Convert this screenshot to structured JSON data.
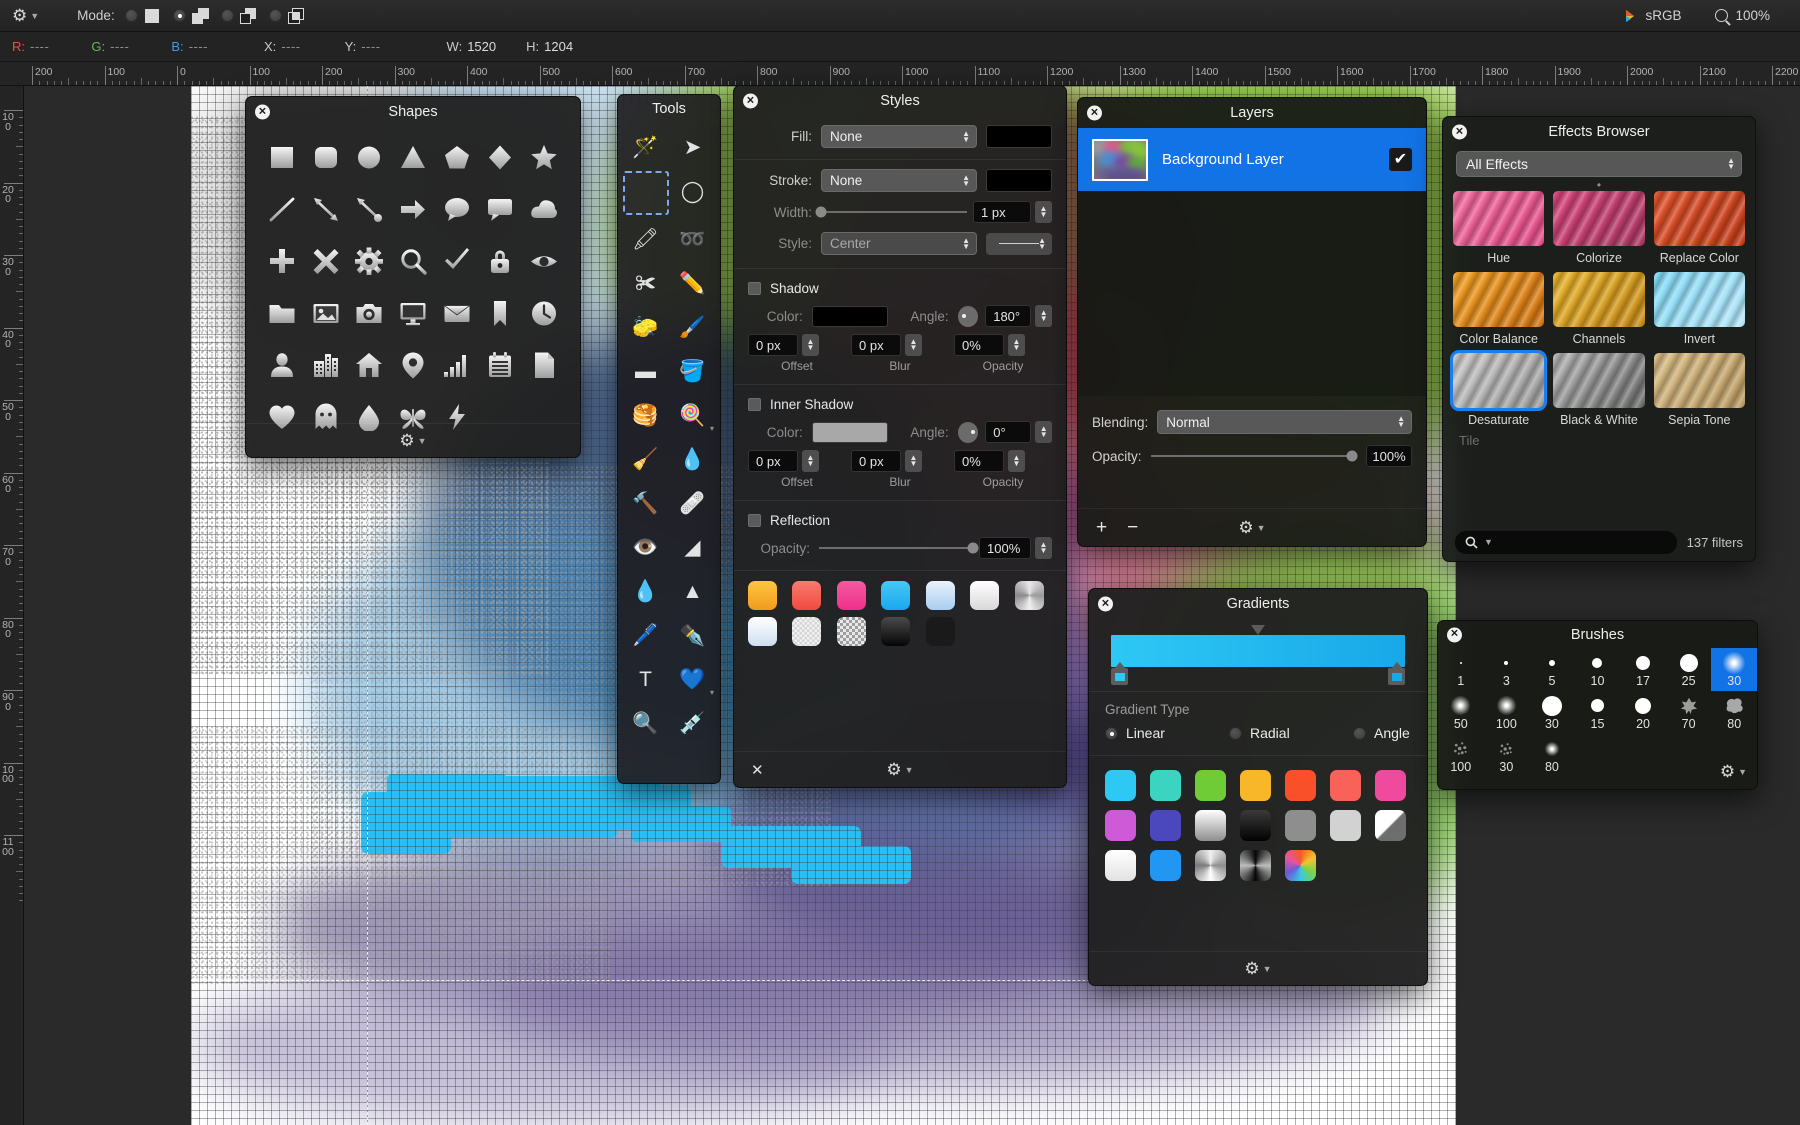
{
  "toolbar": {
    "gear_icon": "gear-icon",
    "mode_label": "Mode:",
    "modes": [
      {
        "name": "new-selection",
        "selected": false,
        "icon": "solid-square-icon"
      },
      {
        "name": "add-to-selection",
        "selected": true,
        "icon": "union-squares-icon"
      },
      {
        "name": "subtract-from-selection",
        "selected": false,
        "icon": "subtract-squares-icon"
      },
      {
        "name": "intersect-selection",
        "selected": false,
        "icon": "intersect-squares-icon"
      }
    ],
    "color_profile": "sRGB",
    "zoom_level": "100%",
    "search_icon": "magnifier-icon"
  },
  "infobar": {
    "r_key": "R:",
    "r_val": "----",
    "g_key": "G:",
    "g_val": "----",
    "b_key": "B:",
    "b_val": "----",
    "x_key": "X:",
    "x_val": "----",
    "y_key": "Y:",
    "y_val": "----",
    "w_key": "W:",
    "w_val": "1520",
    "h_key": "H:",
    "h_val": "1204"
  },
  "rulers": {
    "horizontal_labels": [
      "200",
      "100",
      "0",
      "100",
      "200",
      "300",
      "400",
      "500",
      "600",
      "700",
      "800",
      "900",
      "1000",
      "1100",
      "1200",
      "1300",
      "1400",
      "1500",
      "1600",
      "1700",
      "1800",
      "1900",
      "2000",
      "2100",
      "2200"
    ],
    "vertical_labels": [
      "100",
      "200",
      "300",
      "400",
      "500",
      "600",
      "700",
      "800",
      "900",
      "1000",
      "1100"
    ]
  },
  "shapes_panel": {
    "title": "Shapes",
    "close_icon": "close-icon",
    "gear_icon": "gear-icon",
    "shapes": [
      "square-icon",
      "rounded-square-icon",
      "circle-icon",
      "triangle-icon",
      "pentagon-icon",
      "diamond-icon",
      "star-icon",
      "line-icon",
      "double-arrow-icon",
      "arrow-dot-icon",
      "arrow-right-icon",
      "speech-bubble-round-icon",
      "speech-bubble-square-icon",
      "cloud-icon",
      "plus-icon",
      "cross-icon",
      "gear-icon",
      "magnifier-icon",
      "checkmark-icon",
      "lock-icon",
      "eye-icon",
      "folder-icon",
      "photo-icon",
      "camera-icon",
      "monitor-icon",
      "envelope-icon",
      "bookmark-icon",
      "clock-icon",
      "person-icon",
      "buildings-icon",
      "house-icon",
      "map-pin-icon",
      "bar-chart-icon",
      "calendar-icon",
      "document-icon",
      "heart-icon",
      "ghost-icon",
      "droplet-icon",
      "butterfly-icon",
      "bolt-icon"
    ]
  },
  "tools_panel": {
    "title": "Tools",
    "close_icon": "close-icon",
    "tools": [
      {
        "name": "magic-wand-tool",
        "glyph": "🪄",
        "selected": false
      },
      {
        "name": "move-selection-tool",
        "glyph": "➤",
        "selected": false
      },
      {
        "name": "rectangular-marquee-tool",
        "glyph": "",
        "selected": true
      },
      {
        "name": "elliptical-marquee-tool",
        "glyph": "◯",
        "selected": false
      },
      {
        "name": "quick-select-tool",
        "glyph": "🖍",
        "selected": false
      },
      {
        "name": "lasso-tool",
        "glyph": "➿",
        "selected": false
      },
      {
        "name": "crop-tool",
        "glyph": "✀",
        "selected": false
      },
      {
        "name": "pencil-tool",
        "glyph": "✏️",
        "selected": false
      },
      {
        "name": "eraser-tool",
        "glyph": "🧽",
        "selected": false
      },
      {
        "name": "paintbrush-tool",
        "glyph": "🖌️",
        "selected": false
      },
      {
        "name": "fill-rectangle-tool",
        "glyph": "▬",
        "selected": false
      },
      {
        "name": "paint-bucket-tool",
        "glyph": "🪣",
        "selected": false
      },
      {
        "name": "gradient-tool",
        "glyph": "🥞",
        "selected": false
      },
      {
        "name": "color-picker-palette-tool",
        "glyph": "🍭",
        "selected": false
      },
      {
        "name": "smudge-tool",
        "glyph": "🧹",
        "selected": false
      },
      {
        "name": "burn-tool",
        "glyph": "💧",
        "selected": false
      },
      {
        "name": "clone-stamp-tool",
        "glyph": "🔨",
        "selected": false
      },
      {
        "name": "healing-brush-tool",
        "glyph": "🩹",
        "selected": false
      },
      {
        "name": "red-eye-tool",
        "glyph": "👁️",
        "selected": false
      },
      {
        "name": "background-eraser-tool",
        "glyph": "◢",
        "selected": false
      },
      {
        "name": "blur-tool",
        "glyph": "💧",
        "selected": false
      },
      {
        "name": "sharpen-tool",
        "glyph": "▲",
        "selected": false
      },
      {
        "name": "pen-tool",
        "glyph": "🖊️",
        "selected": false
      },
      {
        "name": "freeform-pen-tool",
        "glyph": "✒️",
        "selected": false
      },
      {
        "name": "text-tool",
        "glyph": "T",
        "selected": false
      },
      {
        "name": "shape-tool",
        "glyph": "💙",
        "selected": false
      },
      {
        "name": "zoom-tool",
        "glyph": "🔍",
        "selected": false
      },
      {
        "name": "eyedropper-tool",
        "glyph": "💉",
        "selected": false
      }
    ]
  },
  "styles_panel": {
    "title": "Styles",
    "close_icon": "close-icon",
    "fill_label": "Fill:",
    "fill_value": "None",
    "fill_color": "#000000",
    "stroke_label": "Stroke:",
    "stroke_value": "None",
    "stroke_color": "#000000",
    "width_label": "Width:",
    "width_value": "1 px",
    "style_label": "Style:",
    "style_value": "Center",
    "shadow": {
      "title": "Shadow",
      "enabled": false,
      "color_label": "Color:",
      "color": "#000000",
      "angle_label": "Angle:",
      "angle_value": "180°",
      "offset_value": "0 px",
      "blur_value": "0 px",
      "opacity_value": "0%",
      "offset_caption": "Offset",
      "blur_caption": "Blur",
      "opacity_caption": "Opacity"
    },
    "inner_shadow": {
      "title": "Inner Shadow",
      "enabled": false,
      "color_label": "Color:",
      "color": "#a8a8a8",
      "angle_label": "Angle:",
      "angle_value": "0°",
      "offset_value": "0 px",
      "blur_value": "0 px",
      "opacity_value": "0%",
      "offset_caption": "Offset",
      "blur_caption": "Blur",
      "opacity_caption": "Opacity"
    },
    "reflection": {
      "title": "Reflection",
      "enabled": false,
      "opacity_label": "Opacity:",
      "opacity_value": "100%"
    },
    "preset_swatches": [
      "orange-gradient",
      "red-gradient",
      "pink-gradient",
      "cyan-gradient",
      "light-blue-gradient",
      "white-gradient",
      "metal-radial",
      "white-blue-gradient",
      "checker-light",
      "checker-gray",
      "black-fade",
      "black-solid"
    ],
    "close_x_icon": "close-x-icon",
    "gear_icon": "gear-icon"
  },
  "layers_panel": {
    "title": "Layers",
    "close_icon": "close-icon",
    "layers": [
      {
        "name": "Background Layer",
        "visible": true,
        "selected": true
      }
    ],
    "blending_label": "Blending:",
    "blending_value": "Normal",
    "opacity_label": "Opacity:",
    "opacity_value": "100%",
    "add_icon": "plus-icon",
    "remove_icon": "minus-icon",
    "gear_icon": "gear-icon"
  },
  "effects_panel": {
    "title": "Effects Browser",
    "close_icon": "close-icon",
    "category_value": "All Effects",
    "effects": [
      {
        "label": "Hue",
        "selected": false,
        "c1": "#f06a9e",
        "c2": "#e24a86"
      },
      {
        "label": "Colorize",
        "selected": false,
        "c1": "#d8437a",
        "c2": "#a83560"
      },
      {
        "label": "Replace Color",
        "selected": false,
        "c1": "#e0522a",
        "c2": "#c03a18"
      },
      {
        "label": "Color Balance",
        "selected": false,
        "c1": "#f0a020",
        "c2": "#d07010"
      },
      {
        "label": "Channels",
        "selected": false,
        "c1": "#e8b32a",
        "c2": "#c68a16"
      },
      {
        "label": "Invert",
        "selected": false,
        "c1": "#7fd8f5",
        "c2": "#b8e8fa"
      },
      {
        "label": "Desaturate",
        "selected": true,
        "c1": "#c8c8c8",
        "c2": "#9a9a9a"
      },
      {
        "label": "Black & White",
        "selected": false,
        "c1": "#b4b4b4",
        "c2": "#6a6a6a"
      },
      {
        "label": "Sepia Tone",
        "selected": false,
        "c1": "#d8bb85",
        "c2": "#b99a62"
      }
    ],
    "cut_off_label": "Tile",
    "search_icon": "search-icon",
    "search_value": "",
    "filter_count": "137 filters"
  },
  "gradients_panel": {
    "title": "Gradients",
    "close_icon": "close-icon",
    "bar_start_color": "#2ec8f5",
    "bar_end_color": "#18a8e8",
    "type_label": "Gradient Type",
    "types": [
      {
        "label": "Linear",
        "selected": true
      },
      {
        "label": "Radial",
        "selected": false
      },
      {
        "label": "Angle",
        "selected": false
      }
    ],
    "swatches": [
      "#2ec8f5",
      "#3ad4c0",
      "#6fcb36",
      "#f8b629",
      "#f9502a",
      "#f86258",
      "#ef4a9e",
      "#cf5ad8",
      "#4b47bd",
      "silver-vertical",
      "black-texture",
      "#8e8e8e",
      "#d2d2d2",
      "white-corner",
      "white-fade",
      "#2196f3",
      "metal-radial",
      "dark-cross",
      "rainbow-wheel"
    ],
    "gear_icon": "gear-icon"
  },
  "brushes_panel": {
    "title": "Brushes",
    "close_icon": "close-icon",
    "brushes": [
      {
        "size": "1",
        "style": "hard",
        "d": 2,
        "active": false
      },
      {
        "size": "3",
        "style": "hard",
        "d": 4,
        "active": false
      },
      {
        "size": "5",
        "style": "hard",
        "d": 6,
        "active": false
      },
      {
        "size": "10",
        "style": "hard",
        "d": 10,
        "active": false
      },
      {
        "size": "17",
        "style": "hard",
        "d": 14,
        "active": false
      },
      {
        "size": "25",
        "style": "hard",
        "d": 18,
        "active": false
      },
      {
        "size": "30",
        "style": "soft",
        "d": 22,
        "active": true
      },
      {
        "size": "50",
        "style": "soft",
        "d": 19,
        "active": false
      },
      {
        "size": "100",
        "style": "soft",
        "d": 19,
        "active": false
      },
      {
        "size": "30",
        "style": "hard",
        "d": 20,
        "active": false
      },
      {
        "size": "15",
        "style": "hard",
        "d": 13,
        "active": false
      },
      {
        "size": "20",
        "style": "hard",
        "d": 16,
        "active": false
      },
      {
        "size": "70",
        "style": "leaf",
        "d": 18,
        "active": false
      },
      {
        "size": "80",
        "style": "cloud",
        "d": 19,
        "active": false
      },
      {
        "size": "100",
        "style": "spatter",
        "d": 17,
        "active": false
      },
      {
        "size": "30",
        "style": "spatter",
        "d": 16,
        "active": false
      },
      {
        "size": "80",
        "style": "soft",
        "d": 14,
        "active": false
      }
    ],
    "gear_icon": "gear-icon"
  }
}
